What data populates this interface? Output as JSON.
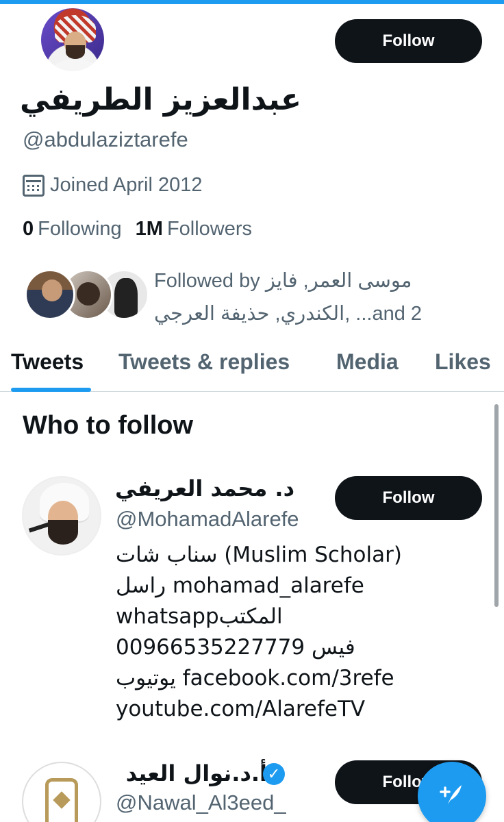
{
  "profile": {
    "display_name": "عبدالعزيز الطريفي",
    "handle": "@abdulaziztarefe",
    "joined": "Joined April 2012",
    "following_count": "0",
    "following_label": "Following",
    "followers_count": "1M",
    "followers_label": "Followers",
    "follow_button": "Follow",
    "followed_by_line1": "Followed by موسى العمر, فايز",
    "followed_by_line2": "الكندري, حذيفة العرجي, ...and 2"
  },
  "tabs": [
    {
      "label": "Tweets",
      "active": true
    },
    {
      "label": "Tweets & replies",
      "active": false
    },
    {
      "label": "Media",
      "active": false
    },
    {
      "label": "Likes",
      "active": false
    }
  ],
  "who_to_follow": {
    "title": "Who to follow",
    "suggestions": [
      {
        "name": "د. محمد العريفي",
        "handle": "@MohamadAlarefe",
        "follow_label": "Follow",
        "bio": [
          "سناب شات (Muslim Scholar)",
          "راسل mohamad_alarefe",
          "whatsappالمكتب",
          "فيس 00966535227779",
          "يوتيوب facebook.com/3refe",
          "youtube.com/AlarefeTV"
        ]
      },
      {
        "name": "أ.د.نوال العيد",
        "handle": "@Nawal_Al3eed_",
        "follow_label": "Follow",
        "verified": true
      }
    ]
  },
  "icons": {
    "calendar": "calendar-icon",
    "verified": "verified-badge-icon",
    "compose": "compose-tweet-icon"
  },
  "colors": {
    "accent": "#1d9bf0",
    "text": "#0f1419",
    "secondary": "#536471"
  }
}
